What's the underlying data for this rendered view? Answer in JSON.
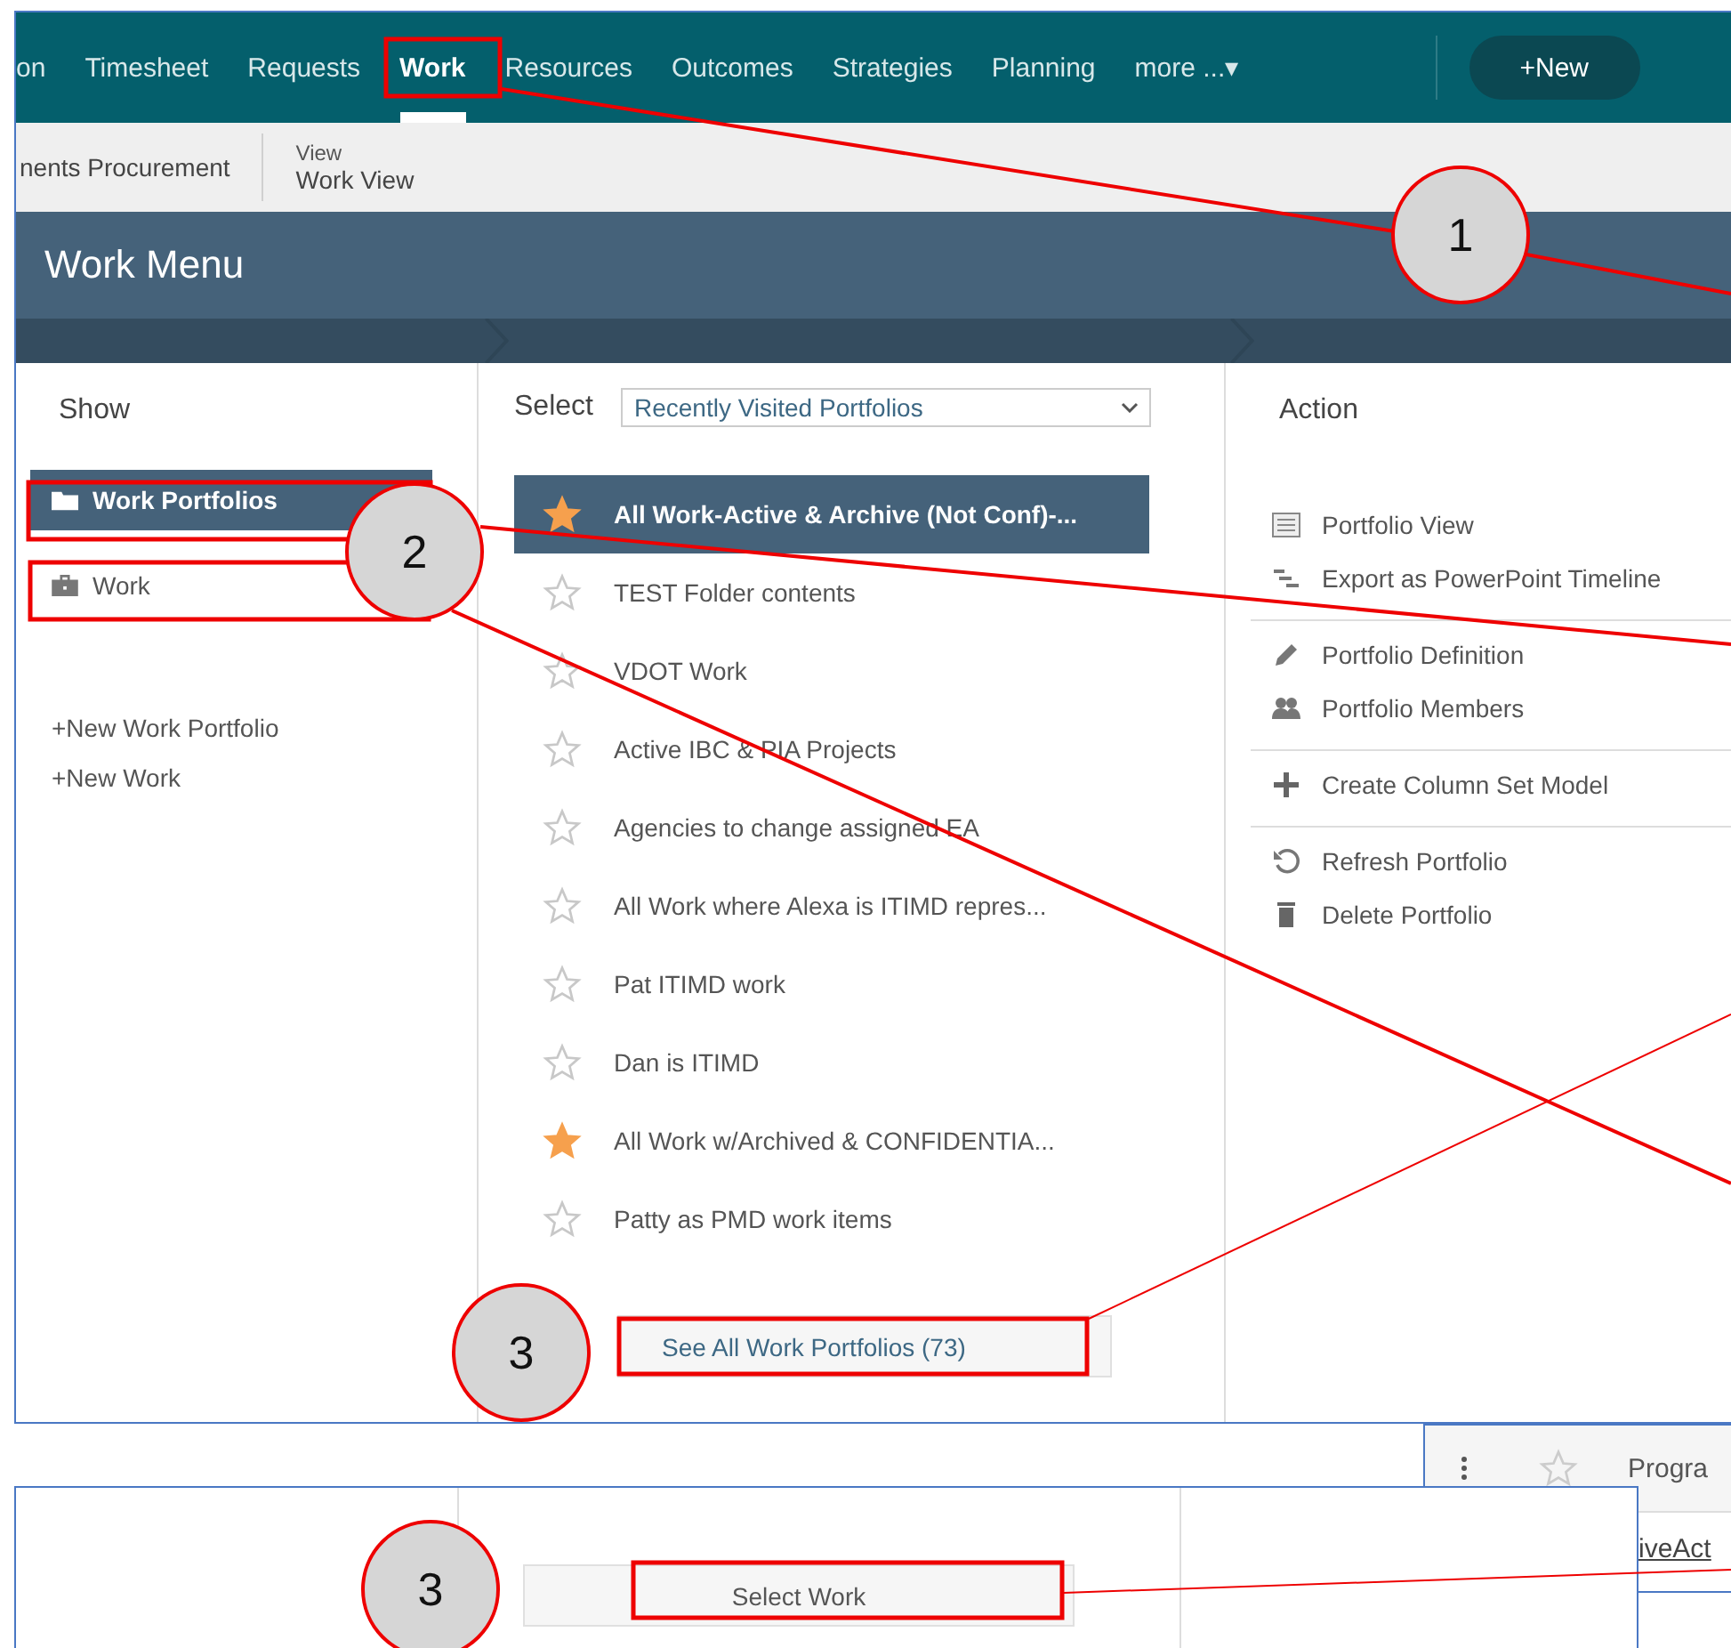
{
  "nav": {
    "items": [
      {
        "label": "on",
        "selected": false
      },
      {
        "label": "Timesheet",
        "selected": false
      },
      {
        "label": "Requests",
        "selected": false
      },
      {
        "label": "Work",
        "selected": true
      },
      {
        "label": "Resources",
        "selected": false
      },
      {
        "label": "Outcomes",
        "selected": false
      },
      {
        "label": "Strategies",
        "selected": false
      },
      {
        "label": "Planning",
        "selected": false
      },
      {
        "label": "more ...▾",
        "selected": false
      }
    ],
    "new_button": "+New"
  },
  "subbar": {
    "crumb": "nents Procurement",
    "view_label": "View",
    "view_value": "Work View"
  },
  "work_menu": {
    "title": "Work Menu"
  },
  "show": {
    "heading": "Show",
    "items": [
      {
        "label": "Work Portfolios",
        "kind": "folder",
        "selected": true
      },
      {
        "label": "Work",
        "kind": "briefcase",
        "selected": false
      }
    ],
    "links": [
      "+New Work Portfolio",
      "+New Work"
    ]
  },
  "select": {
    "label": "Select",
    "dropdown": "Recently Visited Portfolios",
    "portfolios": [
      {
        "label": "All Work-Active & Archive (Not Conf)-...",
        "starred": true,
        "selected": true
      },
      {
        "label": "TEST Folder contents",
        "starred": false,
        "selected": false
      },
      {
        "label": "VDOT Work",
        "starred": false,
        "selected": false
      },
      {
        "label": "Active IBC & PIA Projects",
        "starred": false,
        "selected": false
      },
      {
        "label": "Agencies to change assigned EA",
        "starred": false,
        "selected": false
      },
      {
        "label": "All Work where Alexa is ITIMD repres...",
        "starred": false,
        "selected": false
      },
      {
        "label": "Pat ITIMD work",
        "starred": false,
        "selected": false
      },
      {
        "label": "Dan is ITIMD",
        "starred": false,
        "selected": false
      },
      {
        "label": "All Work w/Archived & CONFIDENTIA...",
        "starred": true,
        "selected": false
      },
      {
        "label": "Patty as PMD work items",
        "starred": false,
        "selected": false
      }
    ],
    "see_all": "See All Work Portfolios (73)"
  },
  "action": {
    "heading": "Action",
    "groups": [
      [
        "Portfolio View",
        "Export as PowerPoint Timeline"
      ],
      [
        "Portfolio Definition",
        "Portfolio Members"
      ],
      [
        "Create Column Set Model"
      ],
      [
        "Refresh Portfolio",
        "Delete Portfolio"
      ]
    ]
  },
  "lower_panel": {
    "button": "Select Work"
  },
  "side_panel": {
    "row_1": "Progra",
    "row_2": "iveAct"
  },
  "callouts": [
    "1",
    "2",
    "3",
    "3"
  ]
}
